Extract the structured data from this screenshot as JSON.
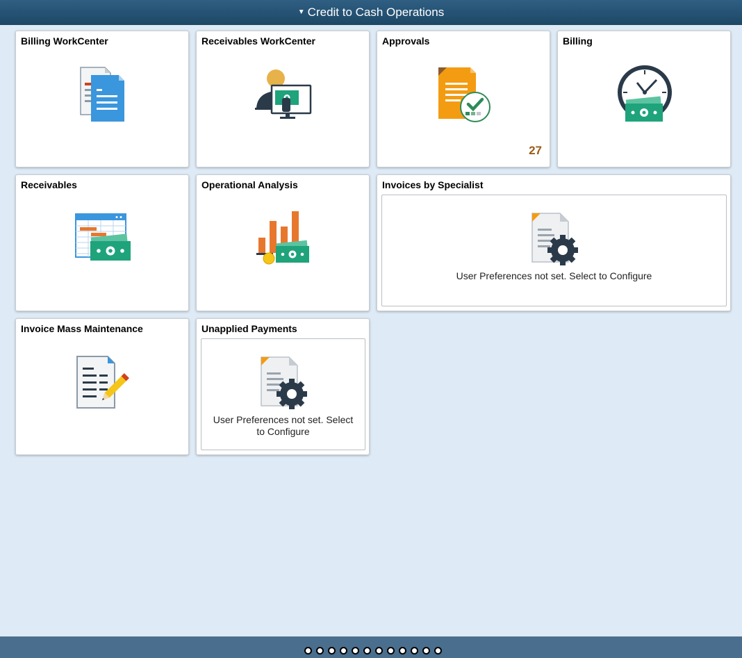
{
  "header": {
    "title": "Credit to Cash Operations",
    "caret": "▼"
  },
  "tiles": {
    "billing_workcenter": {
      "title": "Billing WorkCenter",
      "icon": "documents-icon"
    },
    "receivables_workcenter": {
      "title": "Receivables WorkCenter",
      "icon": "person-monitor-icon"
    },
    "approvals": {
      "title": "Approvals",
      "icon": "approved-document-icon",
      "count": "27"
    },
    "billing": {
      "title": "Billing",
      "icon": "clock-money-icon"
    },
    "receivables": {
      "title": "Receivables",
      "icon": "spreadsheet-money-icon"
    },
    "operational_analysis": {
      "title": "Operational Analysis",
      "icon": "bar-chart-money-icon"
    },
    "invoices_by_specialist": {
      "title": "Invoices by Specialist",
      "icon": "document-gear-icon",
      "message": "User Preferences not set. Select to Configure"
    },
    "invoice_mass_maintenance": {
      "title": "Invoice Mass Maintenance",
      "icon": "document-pencil-icon"
    },
    "unapplied_payments": {
      "title": "Unapplied Payments",
      "icon": "document-gear-icon",
      "message_line1": "User Preferences not set. Select",
      "message_line2": "to Configure"
    }
  },
  "pagination": {
    "total": 12,
    "active_index": 7
  },
  "colors": {
    "header": "#1d4766",
    "background": "#deeaf5",
    "footer": "#4a6e8d",
    "count": "#9c5a17",
    "accent_green": "#26a17a",
    "accent_orange": "#e8772e",
    "accent_blue": "#3a96dd"
  }
}
